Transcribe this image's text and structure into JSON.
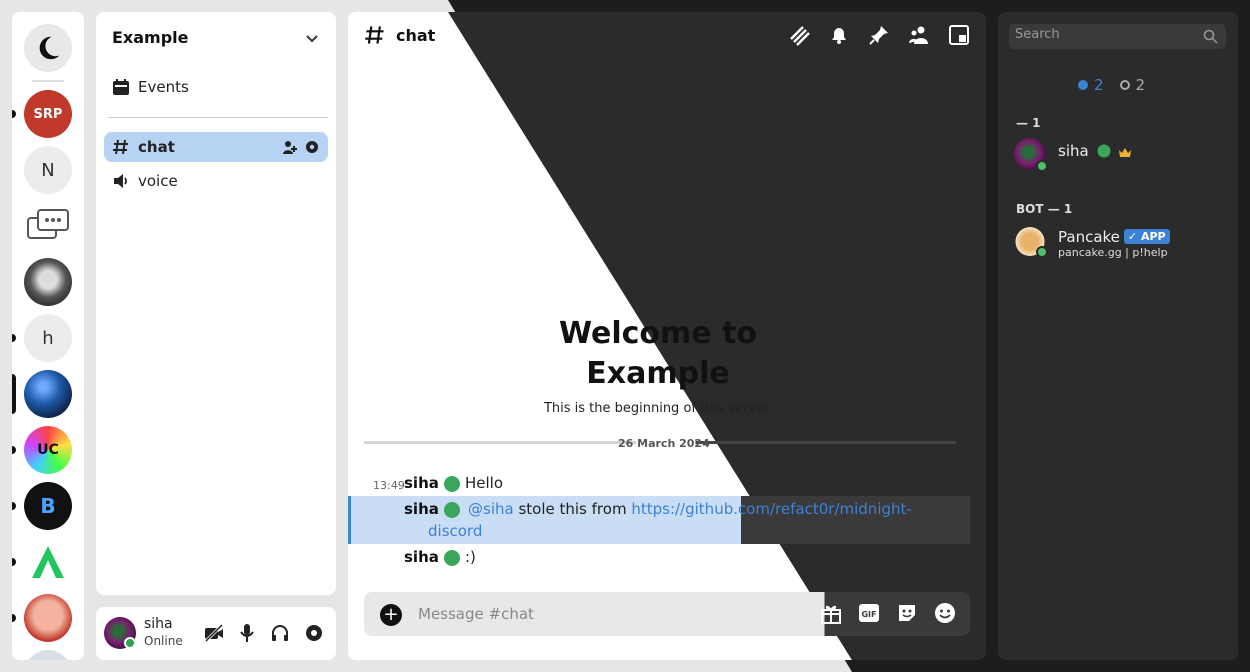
{
  "servers": [
    {
      "label": "",
      "icon": "moon-icon"
    },
    {
      "label": "SRP",
      "icon": "srp-server-icon"
    },
    {
      "label": "N",
      "icon": ""
    },
    {
      "label": "",
      "icon": "chat-bubbles-icon"
    },
    {
      "label": "",
      "icon": "cat-icon"
    },
    {
      "label": "h",
      "icon": ""
    },
    {
      "label": "",
      "icon": "sphere-icon"
    },
    {
      "label": "UC",
      "icon": "uc-server-icon"
    },
    {
      "label": "B",
      "icon": "b-server-icon"
    },
    {
      "label": "",
      "icon": "green-server-icon"
    },
    {
      "label": "",
      "icon": "face-server-icon"
    }
  ],
  "guild": {
    "name": "Example"
  },
  "sidebar": {
    "events_label": "Events",
    "channels": [
      {
        "name": "chat",
        "type": "text"
      },
      {
        "name": "voice",
        "type": "voice"
      }
    ]
  },
  "user": {
    "name": "siha",
    "status": "Online"
  },
  "chat": {
    "channel_name": "chat",
    "welcome_line1": "Welcome to",
    "welcome_line2": "Example",
    "welcome_sub": "This is the beginning of this server.",
    "date": "26 March 2024",
    "messages": [
      {
        "time": "13:49",
        "author": "siha",
        "text": "Hello"
      },
      {
        "author": "siha",
        "mention": "@siha",
        "text": "stole this from",
        "link": "https://github.com/refact0r/midnight-",
        "link_cont": "discord"
      },
      {
        "author": "siha",
        "text": ":)"
      }
    ],
    "composer_placeholder": "Message #chat"
  },
  "members": {
    "search_placeholder": "Search",
    "online_count": "2",
    "offline_count": "2",
    "groups": [
      {
        "title": "— 1",
        "members": [
          {
            "name": "siha"
          }
        ]
      },
      {
        "title": "BOT — 1",
        "members": [
          {
            "name": "Pancake",
            "tag": "APP",
            "sub": "pancake.gg | p!help"
          }
        ]
      }
    ]
  }
}
